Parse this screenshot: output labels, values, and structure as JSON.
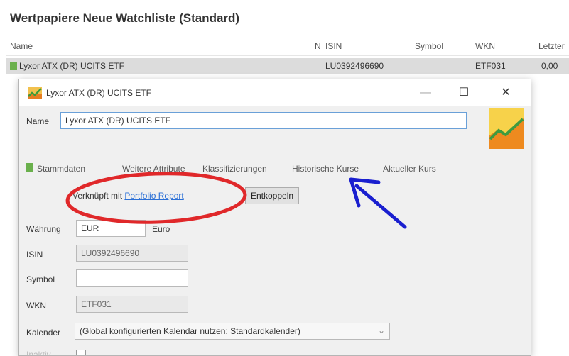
{
  "window_title": "Wertpapiere Neue Watchliste (Standard)",
  "columns": {
    "name": "Name",
    "n": "N",
    "isin": "ISIN",
    "symbol": "Symbol",
    "wkn": "WKN",
    "last": "Letzter"
  },
  "row": {
    "name": "Lyxor ATX (DR) UCITS ETF",
    "isin": "LU0392496690",
    "wkn": "ETF031",
    "last": "0,00"
  },
  "dialog": {
    "title": "Lyxor ATX (DR) UCITS ETF",
    "name_label": "Name",
    "name_value": "Lyxor ATX (DR) UCITS ETF",
    "tabs": [
      "Stammdaten",
      "Weitere Attribute",
      "Klassifizierungen",
      "Historische Kurse",
      "Aktueller Kurs"
    ],
    "linked_prefix": "Verknüpft mit",
    "linked_link": "Portfolio Report",
    "decouple_button": "Entkoppeln",
    "currency_label": "Währung",
    "currency_value": "EUR",
    "currency_name": "Euro",
    "isin_label": "ISIN",
    "isin_value": "LU0392496690",
    "symbol_label": "Symbol",
    "symbol_value": "",
    "wkn_label": "WKN",
    "wkn_value": "ETF031",
    "calendar_label": "Kalender",
    "calendar_value": "(Global konfigurierten Kalendar nutzen: Standardkalender)",
    "last_label": "Inaktiv"
  },
  "annotation_colors": {
    "ellipse": "#e0282a",
    "arrow": "#1a1fcf"
  }
}
